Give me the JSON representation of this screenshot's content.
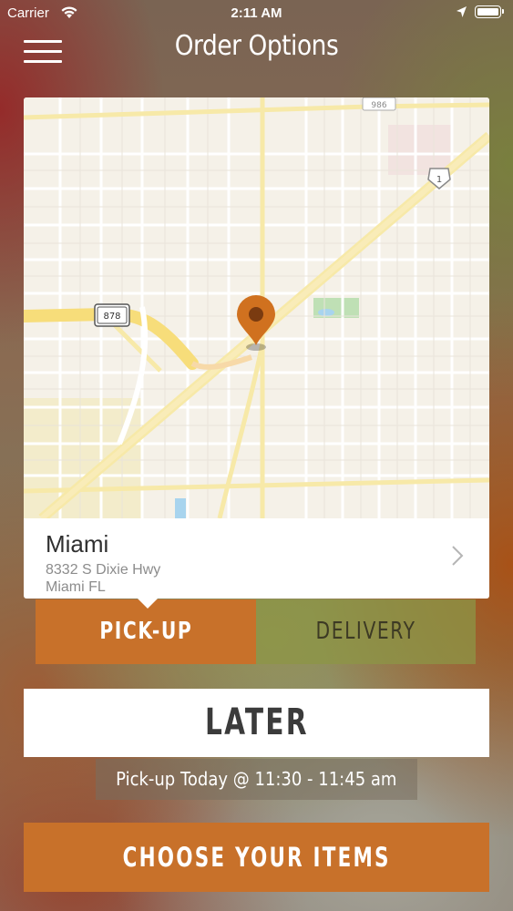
{
  "status_bar": {
    "carrier": "Carrier",
    "time": "2:11 AM"
  },
  "header": {
    "title": "Order Options",
    "menu_icon": "hamburger-menu-icon"
  },
  "map": {
    "route_shields": [
      "878",
      "1",
      "986"
    ],
    "pin_icon": "map-pin-icon",
    "colors": {
      "pin": "#d0711f",
      "highway": "#f7dd7a",
      "land": "#f5f1e8",
      "park": "#bfe0b5",
      "water": "#a8d4ee"
    }
  },
  "store": {
    "name": "Miami",
    "address_line1": "8332 S Dixie Hwy",
    "address_line2": "Miami FL",
    "chevron_icon": "chevron-right-icon"
  },
  "order_type": {
    "pickup_label": "PICK-UP",
    "delivery_label": "DELIVERY",
    "selected": "PICK-UP"
  },
  "timing": {
    "later_label": "LATER",
    "pickup_time_text": "Pick-up Today @ 11:30 - 11:45 am"
  },
  "cta": {
    "choose_items_label": "CHOOSE YOUR ITEMS"
  },
  "colors": {
    "accent": "#c8712a",
    "delivery_tab": "#8c9646"
  }
}
